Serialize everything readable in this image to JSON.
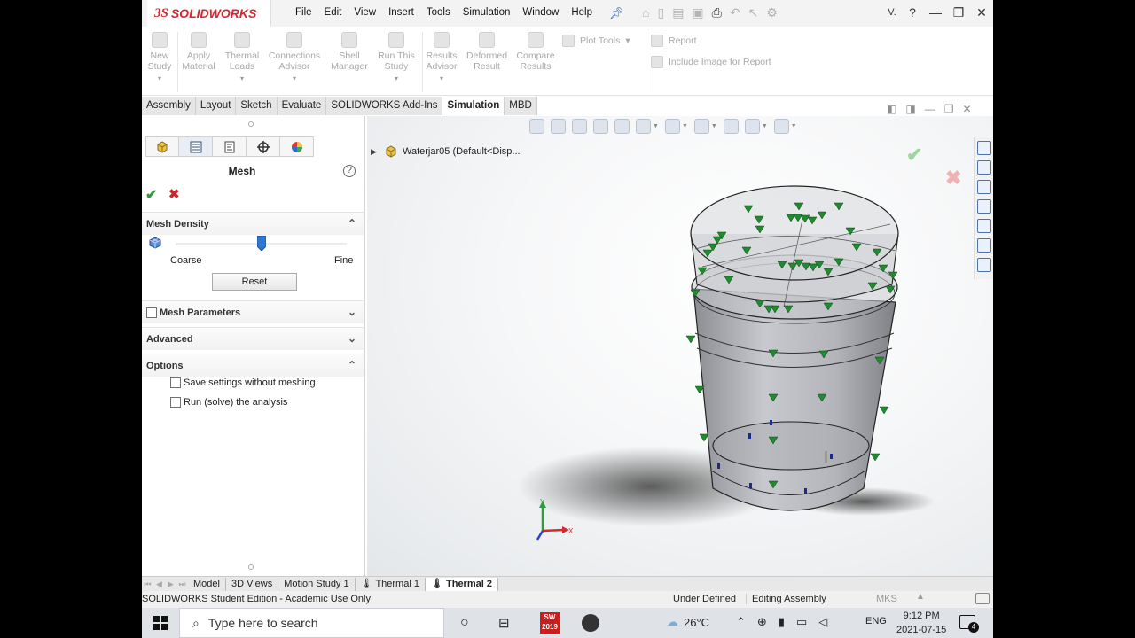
{
  "app": {
    "logo_ds": "3S",
    "logo_text": "SOLIDWORKS"
  },
  "menu": [
    "File",
    "Edit",
    "View",
    "Insert",
    "Tools",
    "Simulation",
    "Window",
    "Help"
  ],
  "titlebar": {
    "user_initial": "V.",
    "help_icon": "?"
  },
  "command_manager": {
    "new_study": [
      "New",
      "Study"
    ],
    "apply_material": [
      "Apply",
      "Material"
    ],
    "thermal_loads": [
      "Thermal",
      "Loads"
    ],
    "connections_advisor": [
      "Connections",
      "Advisor"
    ],
    "shell_manager": [
      "Shell",
      "Manager"
    ],
    "run_this_study": [
      "Run This",
      "Study"
    ],
    "results_advisor": [
      "Results",
      "Advisor"
    ],
    "deformed_result": [
      "Deformed",
      "Result"
    ],
    "compare_results": [
      "Compare",
      "Results"
    ],
    "plot_tools": "Plot Tools",
    "report": "Report",
    "include_image": "Include Image for Report"
  },
  "tabs": [
    "Assembly",
    "Layout",
    "Sketch",
    "Evaluate",
    "SOLIDWORKS Add-Ins",
    "Simulation",
    "MBD"
  ],
  "active_tab": "Simulation",
  "property_manager": {
    "title": "Mesh",
    "mesh_density": {
      "label": "Mesh Density",
      "coarse": "Coarse",
      "fine": "Fine",
      "slider_fraction": 0.5,
      "reset": "Reset"
    },
    "mesh_parameters": {
      "label": "Mesh Parameters",
      "checked": false
    },
    "advanced": "Advanced",
    "options": {
      "label": "Options",
      "save_settings": {
        "label": "Save settings without meshing",
        "checked": false
      },
      "run_analysis": {
        "label": "Run (solve) the analysis",
        "checked": false
      }
    }
  },
  "graphics": {
    "tree_item": "Waterjar05  (Default<Disp...",
    "triad": {
      "x": "X",
      "y": "Y"
    }
  },
  "model_tabs": [
    "Model",
    "3D Views",
    "Motion Study 1",
    "Thermal 1",
    "Thermal 2"
  ],
  "active_model_tab": "Thermal 2",
  "status": {
    "left": "SOLIDWORKS Student Edition - Academic Use Only",
    "definition": "Under Defined",
    "mode": "Editing Assembly",
    "units": "MKS"
  },
  "taskbar": {
    "search_placeholder": "Type here to search",
    "temperature": "26°C",
    "language": "ENG",
    "time": "9:12 PM",
    "date": "2021-07-15",
    "notification_count": "4",
    "sw_badge": "2019"
  },
  "colors": {
    "accent_red": "#d7262f",
    "load_green": "#1f8a2e",
    "fixture_blue": "#1b2a8a",
    "slider_blue": "#2f78d0"
  }
}
